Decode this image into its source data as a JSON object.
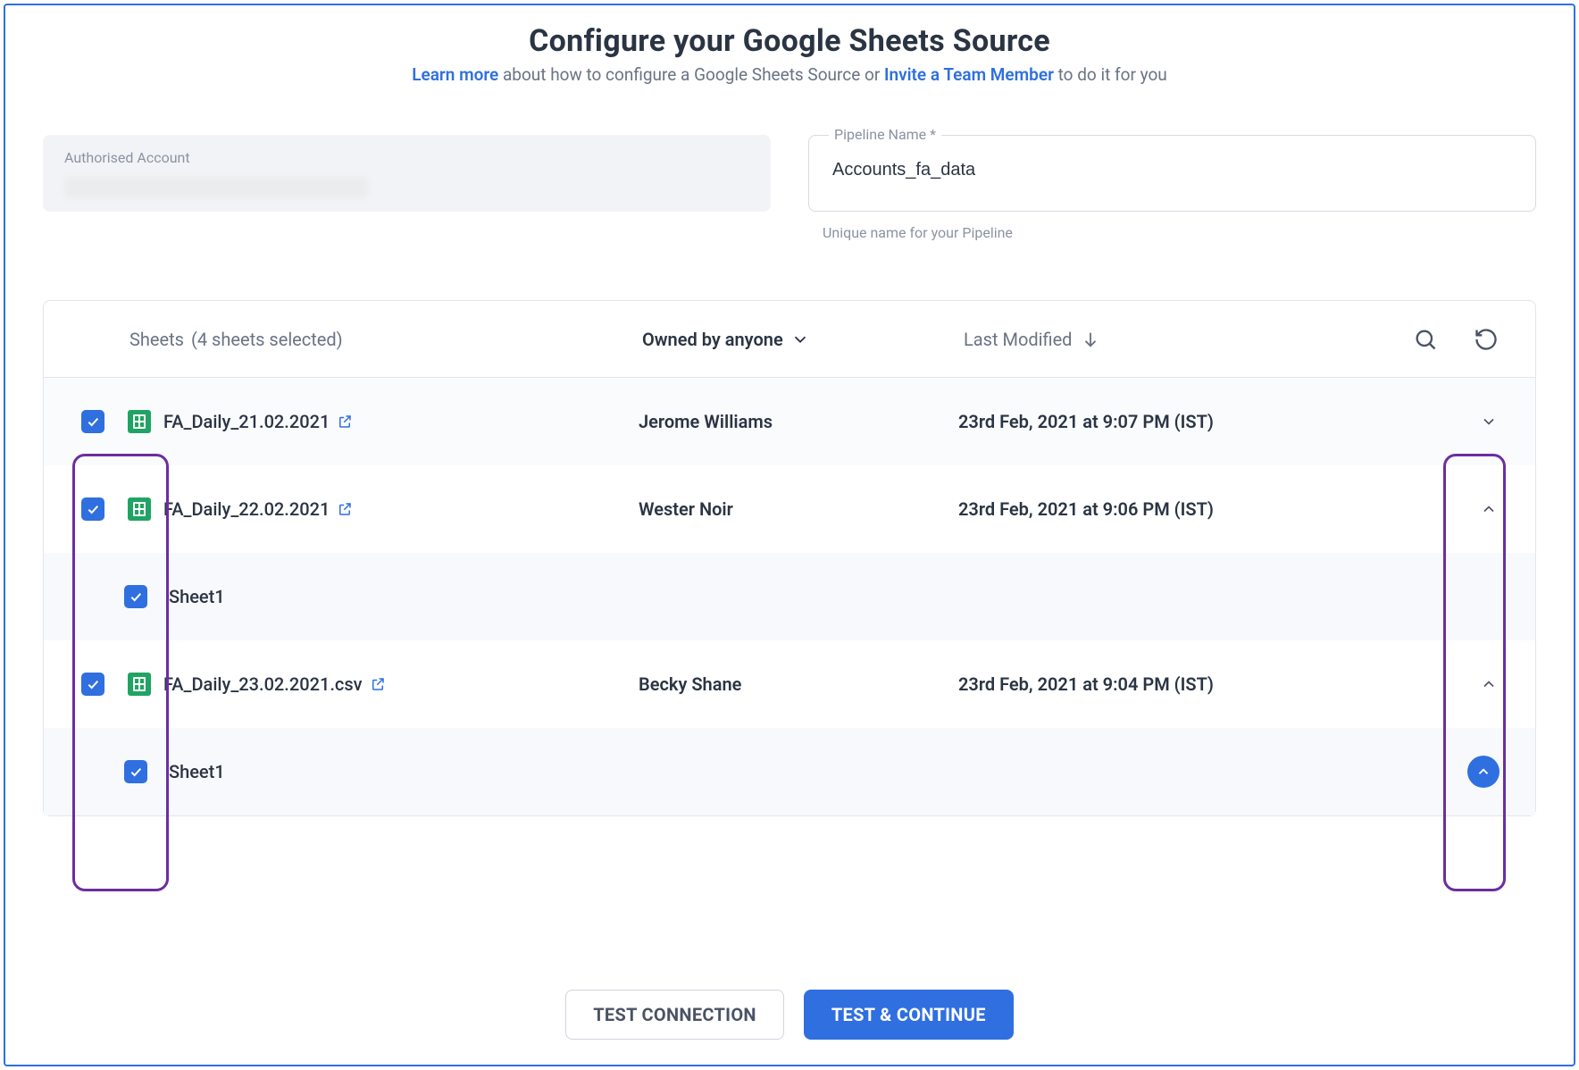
{
  "heading": {
    "title": "Configure your Google Sheets Source",
    "sub_prefix_link": "Learn more",
    "sub_mid": " about how to configure a Google Sheets Source or ",
    "sub_invite_link": "Invite a Team Member",
    "sub_suffix": " to do it for you"
  },
  "fields": {
    "auth_label": "Authorised Account",
    "pipeline_label": "Pipeline Name *",
    "pipeline_value": "Accounts_fa_data",
    "pipeline_helper": "Unique name for your Pipeline"
  },
  "panel": {
    "sheets_label": "Sheets",
    "sheets_count": "(4 sheets selected)",
    "owner_filter": "Owned by anyone",
    "sort_label": "Last Modified"
  },
  "rows": [
    {
      "name": "FA_Daily_21.02.2021",
      "owner": "Jerome Williams",
      "modified": "23rd Feb, 2021 at 9:07 PM (IST)",
      "expanded": false,
      "sub": null
    },
    {
      "name": "FA_Daily_22.02.2021",
      "owner": "Wester Noir",
      "modified": "23rd Feb, 2021 at 9:06 PM (IST)",
      "expanded": true,
      "sub": "Sheet1"
    },
    {
      "name": "FA_Daily_23.02.2021.csv",
      "owner": "Becky Shane",
      "modified": "23rd Feb, 2021 at 9:04 PM (IST)",
      "expanded": true,
      "sub": "Sheet1"
    }
  ],
  "footer": {
    "test_connection": "TEST CONNECTION",
    "test_continue": "TEST & CONTINUE"
  }
}
